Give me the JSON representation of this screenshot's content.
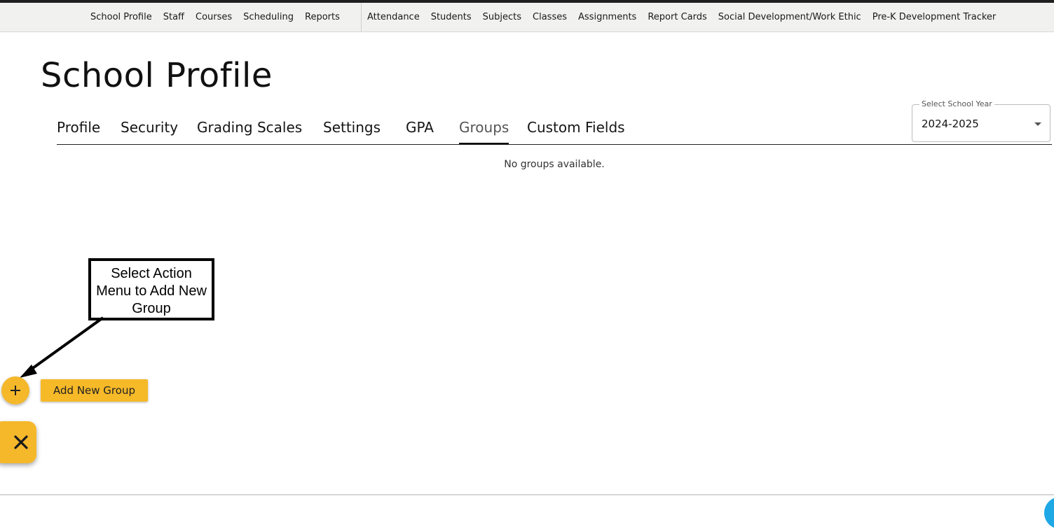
{
  "top_nav": {
    "left_items": [
      "School Profile",
      "Staff",
      "Courses",
      "Scheduling",
      "Reports"
    ],
    "right_items": [
      "Attendance",
      "Students",
      "Subjects",
      "Classes",
      "Assignments",
      "Report Cards",
      "Social Development/Work Ethic",
      "Pre-K Development Tracker"
    ]
  },
  "page": {
    "title": "School Profile",
    "tabs": [
      "Profile",
      "Security",
      "Grading Scales",
      "Settings",
      "GPA",
      "Groups",
      "Custom Fields"
    ],
    "active_tab": "Groups",
    "empty_message": "No groups available."
  },
  "school_year": {
    "label": "Select School Year",
    "value": "2024-2025"
  },
  "callout": {
    "lines": [
      "Select Action",
      "Menu to Add New",
      "Group"
    ]
  },
  "actions": {
    "add_new_group": "Add New Group"
  },
  "colors": {
    "accent": "#f5b82a",
    "chat": "#1ea8e6",
    "nav_bg": "#f1f1ef"
  },
  "icons": {
    "plus": "plus-icon",
    "close": "close-icon",
    "caret": "caret-down-icon",
    "chat": "chat-icon"
  }
}
